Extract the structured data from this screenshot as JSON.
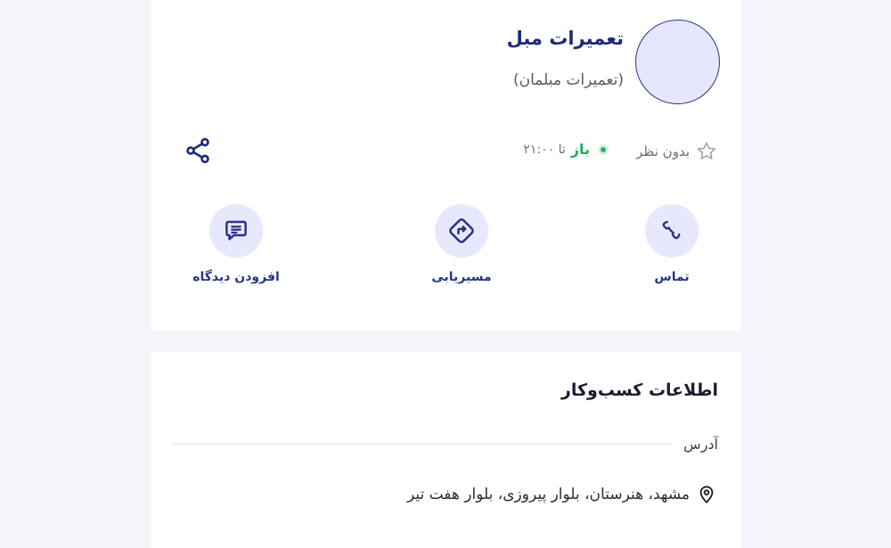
{
  "business": {
    "title": "تعمیرات مبل",
    "category": "(تعمیرات مبلمان)"
  },
  "rating": {
    "text": "بدون نظر",
    "icon": "star-outline-icon"
  },
  "status": {
    "open_label": "باز",
    "until_text": "تا ۲۱:۰۰"
  },
  "actions": {
    "call_label": "تماس",
    "route_label": "مسیریابی",
    "review_label": "افزودن دیدگاه"
  },
  "info": {
    "section_title": "اطلاعات کسب‌وکار",
    "address_label": "آدرس",
    "address_value": "مشهد، هنرستان، بلوار پیروزی، بلوار هفت تیر"
  },
  "colors": {
    "primary": "#2b3388",
    "accent_bg": "#e8e8fc",
    "open_green": "#26a866",
    "page_bg": "#f4f5fa"
  }
}
